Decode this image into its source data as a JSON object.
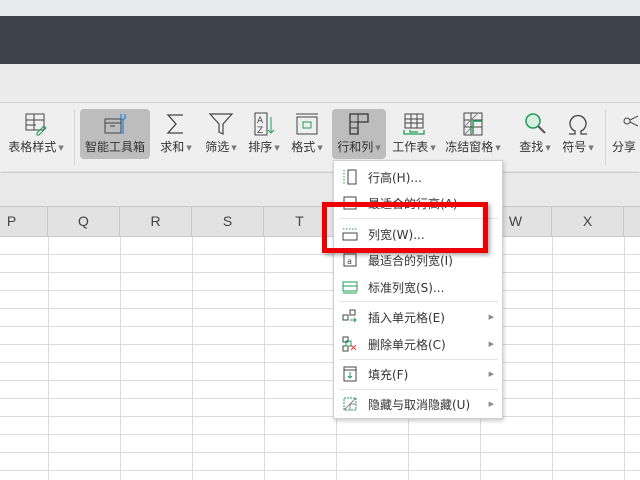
{
  "ribbon": {
    "items": [
      {
        "label": "表格样式",
        "icon": "table-style-icon",
        "caret": true
      },
      {
        "label": "智能工具箱",
        "icon": "toolbox-icon",
        "caret": false,
        "active": true
      },
      {
        "label": "求和",
        "icon": "sigma-icon",
        "caret": true
      },
      {
        "label": "筛选",
        "icon": "filter-icon",
        "caret": true
      },
      {
        "label": "排序",
        "icon": "sort-az-icon",
        "caret": true
      },
      {
        "label": "格式",
        "icon": "format-icon",
        "caret": true
      },
      {
        "label": "行和列",
        "icon": "row-col-icon",
        "caret": true,
        "active": true
      },
      {
        "label": "工作表",
        "icon": "worksheet-icon",
        "caret": true
      },
      {
        "label": "冻结窗格",
        "icon": "freeze-panes-icon",
        "caret": true
      },
      {
        "label": "查找",
        "icon": "search-icon",
        "caret": true
      },
      {
        "label": "符号",
        "icon": "omega-icon",
        "caret": true
      },
      {
        "label": "分享",
        "icon": "share-icon",
        "caret": false
      }
    ]
  },
  "columns": [
    "P",
    "Q",
    "R",
    "S",
    "T",
    "",
    "",
    "W",
    "X"
  ],
  "menu": {
    "items": [
      {
        "label": "行高(H)...",
        "icon": "row-height-icon"
      },
      {
        "label": "最适合的行高(A)",
        "icon": "autofit-row-icon"
      },
      {
        "label": "列宽(W)...",
        "icon": "column-width-icon",
        "highlighted": true
      },
      {
        "label": "最适合的列宽(I)",
        "icon": "autofit-column-icon"
      },
      {
        "label": "标准列宽(S)...",
        "icon": "standard-width-icon"
      },
      {
        "label": "插入单元格(E)",
        "icon": "insert-cell-icon",
        "submenu": true
      },
      {
        "label": "删除单元格(C)",
        "icon": "delete-cell-icon",
        "submenu": true
      },
      {
        "label": "填充(F)",
        "icon": "fill-icon",
        "submenu": true
      },
      {
        "label": "隐藏与取消隐藏(U)",
        "icon": "hide-unhide-icon",
        "submenu": true
      }
    ]
  },
  "colors": {
    "accent_green": "#1f9d55",
    "highlight_red": "#ee0000",
    "dark_band": "#3e424c"
  }
}
